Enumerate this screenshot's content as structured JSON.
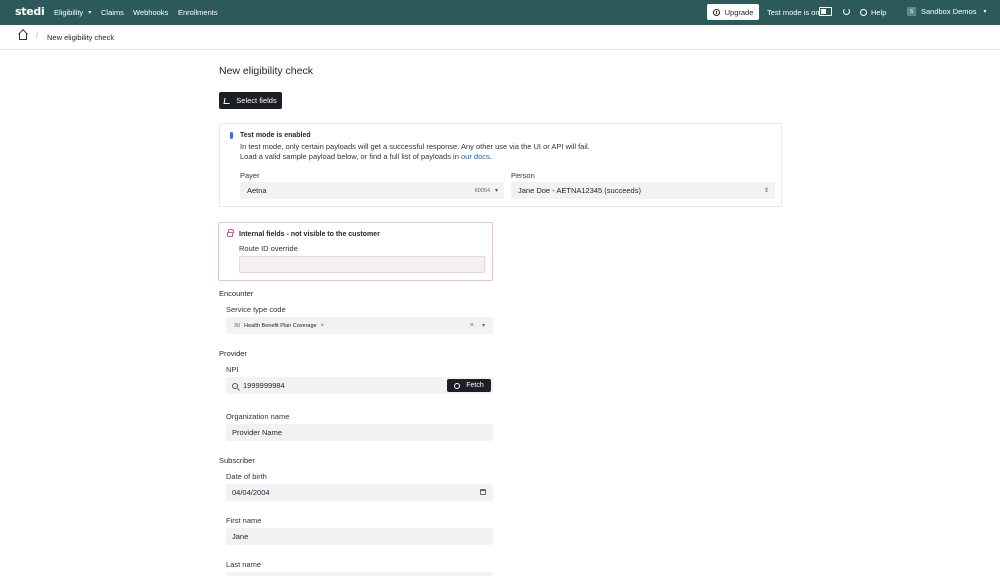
{
  "nav": {
    "logo": "stedi",
    "items": [
      {
        "label": "Eligibility",
        "has_caret": true
      },
      {
        "label": "Claims"
      },
      {
        "label": "Webhooks"
      },
      {
        "label": "Enrollments"
      }
    ],
    "upgrade_label": "Upgrade",
    "test_mode_label": "Test mode is on",
    "help_label": "Help",
    "org_initial": "S",
    "org_name": "Sandbox Demos"
  },
  "breadcrumb": {
    "separator": "/",
    "current": "New eligibility check"
  },
  "page": {
    "title": "New eligibility check",
    "select_fields_label": "Select fields"
  },
  "test_mode_card": {
    "title": "Test mode is enabled",
    "desc_line1": "In test mode, only certain payloads will get a successful response. Any other use via the UI or API will fail.",
    "desc_line2_prefix": "Load a valid sample payload below, or find a full list of payloads in",
    "desc_link": "our docs",
    "desc_suffix": ".",
    "payer_label": "Payer",
    "payer_value": "Aetna",
    "payer_code": "60054",
    "person_label": "Person",
    "person_value": "Jane Doe - AETNA12345 (succeeds)"
  },
  "internal_card": {
    "title": "Internal fields - not visible to the customer",
    "route_label": "Route ID override",
    "route_value": ""
  },
  "encounter": {
    "title": "Encounter",
    "service_label": "Service type code",
    "chip_code": "30",
    "chip_label": "Health Benefit Plan Coverage",
    "chip_remove": "×",
    "clear": "×",
    "caret": "⌄"
  },
  "provider": {
    "title": "Provider",
    "npi_label": "NPI",
    "npi_value": "1999999984",
    "fetch_label": "Fetch",
    "org_label": "Organization name",
    "org_value": "Provider Name"
  },
  "subscriber": {
    "title": "Subscriber",
    "dob_label": "Date of birth",
    "dob_value": "04/04/2004",
    "first_label": "First name",
    "first_value": "Jane",
    "last_label": "Last name"
  }
}
